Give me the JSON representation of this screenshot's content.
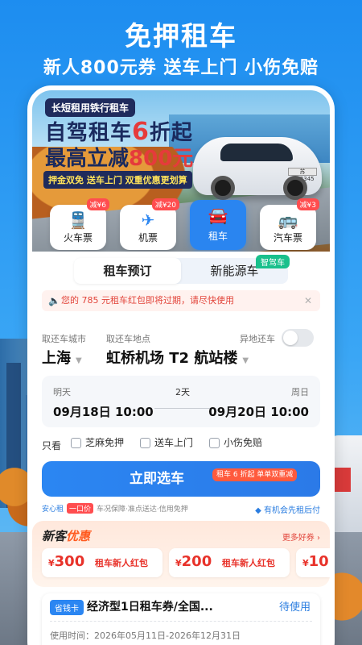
{
  "hero": {
    "title": "免押租车",
    "subtitle": "新人800元券  送车上门  小伤免赔"
  },
  "banner": {
    "tag": "长短租用铁行租车",
    "headline_a": "自驾租车",
    "headline_discount": "6",
    "headline_b": "折起",
    "headline2_a": "最高立减",
    "headline2_amount": "800元",
    "perks": "押金双免  送车上门  双重优惠更划算",
    "plate": "苏A·12345"
  },
  "categories": [
    {
      "name": "train",
      "label": "火车票",
      "badge": "减¥6",
      "icon": "train-icon"
    },
    {
      "name": "flight",
      "label": "机票",
      "badge": "减¥20",
      "icon": "plane-icon"
    },
    {
      "name": "car",
      "label": "租车",
      "badge": "",
      "icon": "car-icon",
      "active": true
    },
    {
      "name": "bus",
      "label": "汽车票",
      "badge": "减¥3",
      "icon": "bus-icon"
    }
  ],
  "booking": {
    "tabs": [
      "租车预订",
      "新能源车"
    ],
    "tab_badge": "智驾车",
    "notice": "您的 785 元租车红包即将过期，请尽快使用",
    "city_label": "取还车城市",
    "location_label": "取还车地点",
    "remote_label": "异地还车",
    "city": "上海",
    "location": "虹桥机场 T2 航站楼",
    "pickup_day_label": "明天",
    "pickup_time": "09月18日 10:00",
    "duration": "2天",
    "return_day_label": "周日",
    "return_time": "09月20日 10:00",
    "filter_label": "只看",
    "filters": [
      "芝麻免押",
      "送车上门",
      "小伤免赔"
    ],
    "cta": "立即选车",
    "cta_badge": "租车 6 折起 单单双重减",
    "assurance_brand": "安心租",
    "assurance_tag": "一口价",
    "assurance_text": "车况保障·准点送达·信用免押",
    "flex_text": "有机会先租后付"
  },
  "promo": {
    "title_a": "新客",
    "title_b": "优惠",
    "more": "更多好券 ›",
    "coupons": [
      {
        "amount": "300",
        "name": "租车新人红包"
      },
      {
        "amount": "200",
        "name": "租车新人红包"
      },
      {
        "amount": "10",
        "name": ""
      }
    ]
  },
  "voucher": {
    "tag": "省钱卡",
    "title": "经济型1日租车券/全国...",
    "status": "待使用",
    "time": "使用时间：2026年05月11日-2026年12月31日"
  },
  "colors": {
    "accent": "#2a85f0",
    "danger": "#e8322a",
    "promo_orange": "#ff5a1f"
  }
}
